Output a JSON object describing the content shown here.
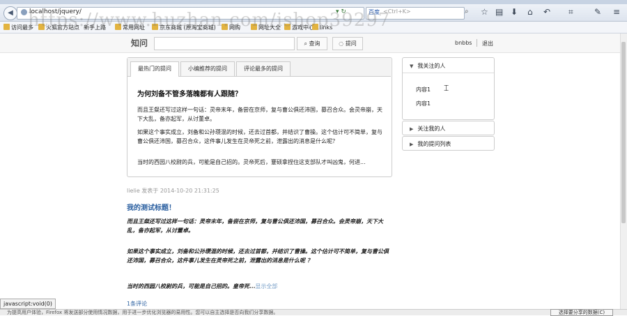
{
  "browser": {
    "url": "localhost/jquery/",
    "search_engine": "百度",
    "search_placeholder": "<Ctrl+K>",
    "bookmarks": [
      "访问最多",
      "火狐官方站点",
      "新手上路",
      "常用网址",
      "京东商城 (原淘宝商城)",
      "网购",
      "网址大全",
      "游戏中心",
      "links"
    ],
    "watermark": "https://www.huzhan.com/ishop39297",
    "status_tip": "javascript:void(0)",
    "status_text": "为提高用户体验，Firefox 将发送部分使用情况数据，用于进一步优化浏览器的易用性。您可以自主选择是否向我们分享数据。",
    "status_button": "选择要分享的数据(C)"
  },
  "header": {
    "logo": "知问",
    "search_button": "查询",
    "ask_button": "提问",
    "username": "bnbbs",
    "logout": "退出"
  },
  "tabs": {
    "items": [
      {
        "label": "最热门的提问",
        "active": true
      },
      {
        "label": "小编推荐的提问",
        "active": false
      },
      {
        "label": "评论最多的提问",
        "active": false
      }
    ],
    "question": {
      "title": "为何刘备不管多落魄都有人跟随？",
      "paragraphs": [
        "而且王粲还写过这样一句话：灵帝末年，备尝在京师，复与曹公俱还沛国，募召合众。会灵帝崩，天下大乱，备亦起军，从讨董卓。",
        "如果这个事实成立，刘备和公孙瓒混的时候，还去过首都，并结识了曹操。这个估计可不简单，复与曹公俱还沛国，募召合众，这件事儿发生在灵帝死之前，泄露出的消息是什么呢？",
        "当时的西园八校尉的兵，可能是自己招的。灵帝死后，蹇硕拿捏住这支部队才叫凶鬼，何进..."
      ]
    }
  },
  "post": {
    "meta": "lielie 发表于 2014-10-20 21:31:25",
    "title": "我的测试标题！",
    "paragraphs": [
      "而且王粲还写过这样一句话：灵帝末年，备尝在京师，复与曹公俱还沛国，募召合众。会灵帝崩，天下大乱，备亦起军，从讨董卓。",
      "如果这个事实成立，刘备和公孙瓒混的时候，还去过首都，并结识了曹操。这个估计可不简单，复与曹公俱还沛国，募召合众，这件事儿发生在灵帝死之前，泄露出的消息是什么呢 ？",
      "当时的西园八校尉的兵，可能是自己招的。皇帝死..."
    ],
    "show_all": "显示全部",
    "comments": "1条评论"
  },
  "sidebar": {
    "following": {
      "title": "我关注的人",
      "items": [
        "内容1",
        "内容1"
      ]
    },
    "followers": {
      "title": "关注我的人"
    },
    "my_questions": {
      "title": "我的提问列表"
    }
  }
}
